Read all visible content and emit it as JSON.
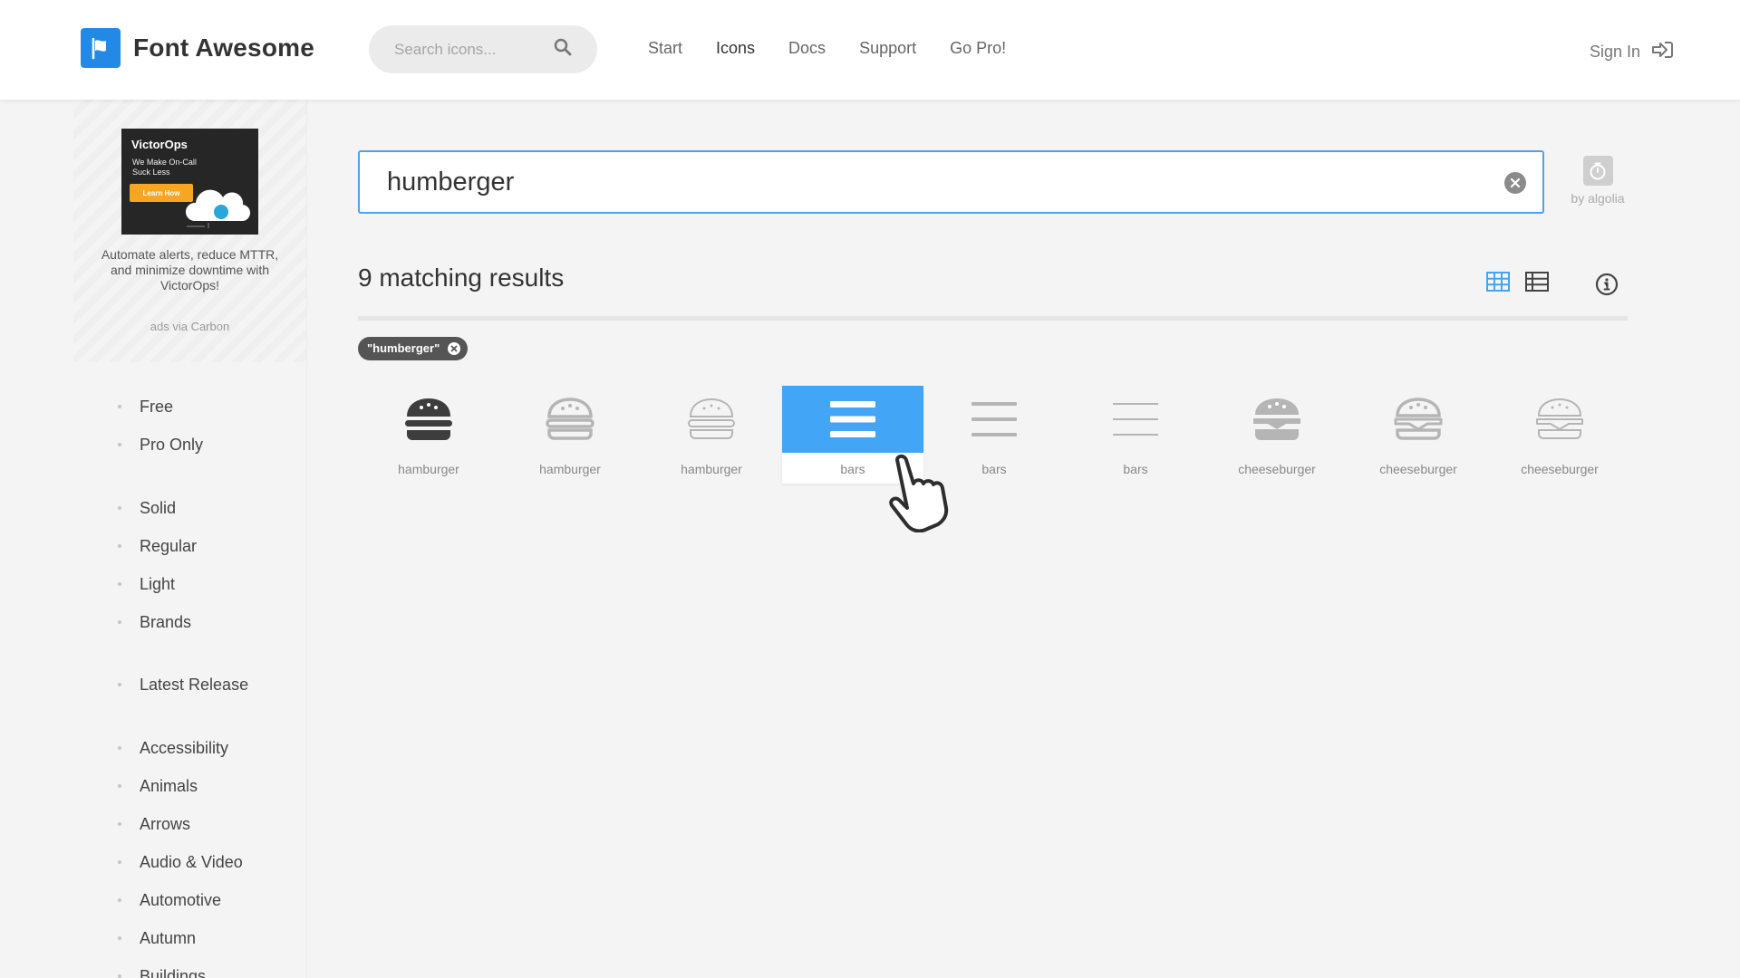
{
  "header": {
    "brand": "Font Awesome",
    "search_placeholder": "Search icons...",
    "nav": [
      "Start",
      "Icons",
      "Docs",
      "Support",
      "Go Pro!"
    ],
    "active_nav": "Icons",
    "sign_in": "Sign In"
  },
  "ad": {
    "banner_brand": "VictorOps",
    "banner_tagline": "We Make On-Call Suck Less",
    "banner_button": "Learn How",
    "copy": "Automate alerts, reduce MTTR, and minimize downtime with VictorOps!",
    "via": "ads via Carbon"
  },
  "sidebar": {
    "license": [
      "Free",
      "Pro Only"
    ],
    "styles": [
      "Solid",
      "Regular",
      "Light",
      "Brands"
    ],
    "release": [
      "Latest Release"
    ],
    "categories": [
      "Accessibility",
      "Animals",
      "Arrows",
      "Audio & Video",
      "Automotive",
      "Autumn",
      "Buildings"
    ]
  },
  "search": {
    "query": "humberger",
    "powered_by": "by algolia"
  },
  "results": {
    "count_label": "9 matching results",
    "filter_tag": "\"humberger\"",
    "icons": [
      {
        "name": "hamburger",
        "style": "solid",
        "icon": "hamburger-icon"
      },
      {
        "name": "hamburger",
        "style": "regular",
        "icon": "hamburger-icon"
      },
      {
        "name": "hamburger",
        "style": "light",
        "icon": "hamburger-icon"
      },
      {
        "name": "bars",
        "style": "solid",
        "icon": "bars-icon",
        "selected": true
      },
      {
        "name": "bars",
        "style": "regular",
        "icon": "bars-icon"
      },
      {
        "name": "bars",
        "style": "light",
        "icon": "bars-icon"
      },
      {
        "name": "cheeseburger",
        "style": "solid",
        "icon": "cheeseburger-icon"
      },
      {
        "name": "cheeseburger",
        "style": "regular",
        "icon": "cheeseburger-icon"
      },
      {
        "name": "cheeseburger",
        "style": "light",
        "icon": "cheeseburger-icon"
      }
    ]
  },
  "colors": {
    "accent": "#228ae6",
    "selected": "#42a5f5",
    "icon_dark": "#3d3d3d",
    "icon_muted": "#b5b5b5"
  }
}
